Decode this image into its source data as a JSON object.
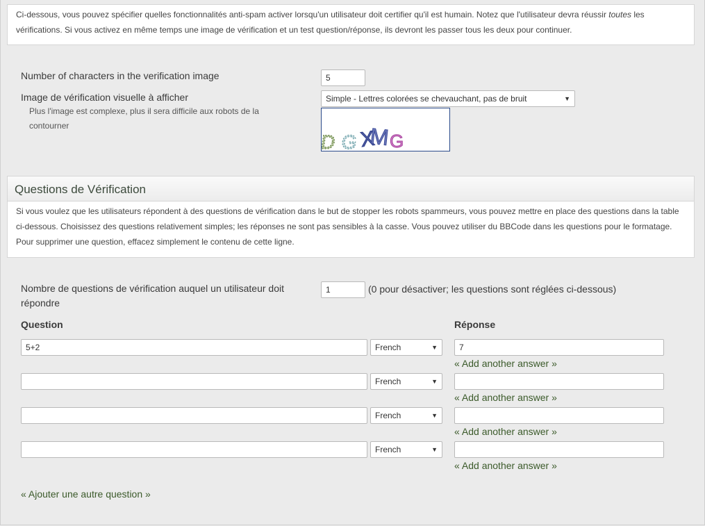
{
  "intro": {
    "text_before_em": "Ci-dessous, vous pouvez spécifier quelles fonctionnalités anti-spam activer lorsqu'un utilisateur doit certifier qu'il est humain. Notez que l'utilisateur devra réussir ",
    "em": "toutes",
    "text_after_em": " les vérifications. Si vous activez en même temps une image de vérification et un test question/réponse, ils devront les passer tous les deux pour continuer."
  },
  "image_settings": {
    "chars_label": "Number of characters in the verification image",
    "chars_value": "5",
    "image_label": "Image de vérification visuelle à afficher",
    "image_hint": "Plus l'image est complexe, plus il sera difficile aux robots de la contourner",
    "image_select": "Simple - Lettres colorées se chevauchant, pas de bruit",
    "captcha_letters": [
      "D",
      "G",
      "X",
      "M",
      "G"
    ]
  },
  "questions_section": {
    "title": "Questions de Vérification",
    "description": "Si vous voulez que les utilisateurs répondent à des questions de vérification dans le but de stopper les robots spammeurs, vous pouvez mettre en place des questions dans la table ci-dessous. Choisissez des questions relativement simples; les réponses ne sont pas sensibles à la casse. Vous pouvez utiliser du BBCode dans les questions pour le formatage. Pour supprimer une question, effacez simplement le contenu de cette ligne.",
    "count_label": "Nombre de questions de vérification auquel un utilisateur doit répondre",
    "count_value": "1",
    "count_note": "(0 pour désactiver; les questions sont réglées ci-dessous)",
    "question_header": "Question",
    "answer_header": "Réponse",
    "rows": [
      {
        "question": "5+2",
        "language": "French",
        "answer": "7",
        "add_answer": "« Add another answer »"
      },
      {
        "question": "",
        "language": "French",
        "answer": "",
        "add_answer": "« Add another answer »"
      },
      {
        "question": "",
        "language": "French",
        "answer": "",
        "add_answer": "« Add another answer »"
      },
      {
        "question": "",
        "language": "French",
        "answer": "",
        "add_answer": "« Add another answer »"
      }
    ],
    "add_question": "« Ajouter une autre question »"
  }
}
